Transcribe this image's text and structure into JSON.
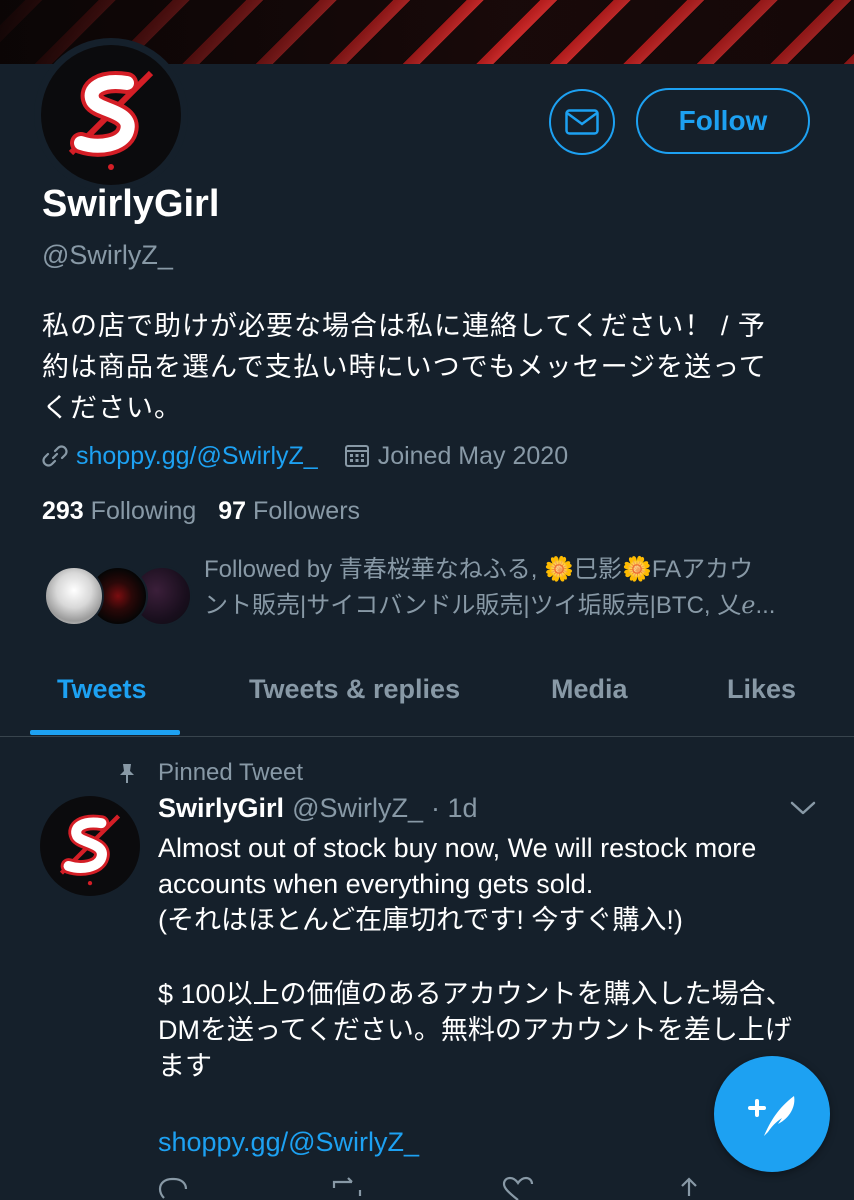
{
  "profile": {
    "display_name": "SwirlyGirl",
    "handle": "@SwirlyZ_",
    "bio_lines": [
      "私の店で助けが必要な場合は私に連絡してください！ / 予",
      "約は商品を選んで支払い時にいつでもメッセージを送って",
      "ください。"
    ],
    "website": "shoppy.gg/@SwirlyZ_",
    "joined": "Joined May 2020",
    "following_count": "293",
    "following_label": "Following",
    "followers_count": "97",
    "followers_label": "Followers",
    "followed_by_lines": [
      "Followed by 青春桜華なねふる, 🌼巳影🌼FAアカウ",
      "ント販売|サイコバンドル販売|ツイ垢販売|BTC, 乂ℯ..."
    ],
    "avatar_letter": "S"
  },
  "buttons": {
    "follow_label": "Follow",
    "message_icon": "mail-icon"
  },
  "tabs": [
    {
      "label": "Tweets",
      "active": true
    },
    {
      "label": "Tweets & replies",
      "active": false
    },
    {
      "label": "Media",
      "active": false
    },
    {
      "label": "Likes",
      "active": false
    }
  ],
  "tweet": {
    "pinned_label": "Pinned Tweet",
    "name": "SwirlyGirl",
    "handle": "@SwirlyZ_",
    "time": "· 1d",
    "paragraphs": [
      "Almost out of stock buy now, We will restock more accounts when everything gets sold.",
      "(それはほとんど在庫切れです! 今すぐ購入!)",
      "",
      "$ 100以上の価値のあるアカウントを購入した場合、DMを送ってください。無料のアカウントを差し上げます",
      ""
    ],
    "link": "shoppy.gg/@SwirlyZ_"
  },
  "colors": {
    "background": "#15202b",
    "accent": "#1da1f2",
    "secondary_text": "#8899a6",
    "divider": "#38444d"
  }
}
